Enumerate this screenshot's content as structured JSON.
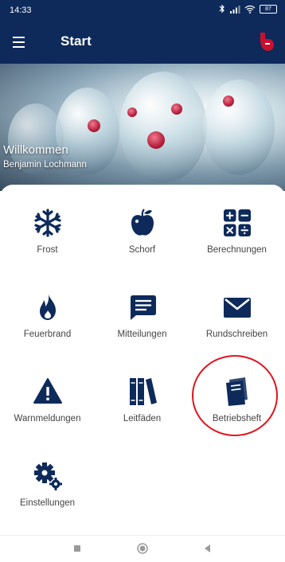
{
  "status_bar": {
    "time": "14:33",
    "battery": "87"
  },
  "app_bar": {
    "title": "Start"
  },
  "hero": {
    "welcome": "Willkommen",
    "user_name": "Benjamin Lochmann"
  },
  "tiles": [
    {
      "label": "Frost",
      "icon": "snowflake-icon"
    },
    {
      "label": "Schorf",
      "icon": "apple-icon"
    },
    {
      "label": "Berechnungen",
      "icon": "calculator-icon"
    },
    {
      "label": "Feuerbrand",
      "icon": "flame-icon"
    },
    {
      "label": "Mitteilungen",
      "icon": "message-icon"
    },
    {
      "label": "Rundschreiben",
      "icon": "envelope-icon"
    },
    {
      "label": "Warnmeldungen",
      "icon": "warning-icon"
    },
    {
      "label": "Leitfäden",
      "icon": "books-icon"
    },
    {
      "label": "Betriebsheft",
      "icon": "notebook-icon"
    },
    {
      "label": "Einstellungen",
      "icon": "gears-icon"
    }
  ],
  "colors": {
    "primary": "#0d2a5b",
    "icon": "#0d2a5b",
    "highlight": "#e0141e",
    "logo": "#c8102e"
  }
}
